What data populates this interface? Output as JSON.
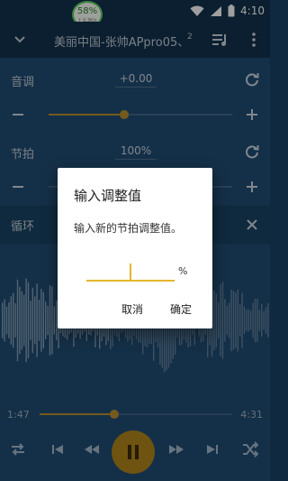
{
  "status_bar": {
    "net_percent": "58%",
    "net_speed": "↑ 0.3K/s",
    "time": "4:10"
  },
  "title_bar": {
    "title": "美丽中国-张帅APpro05、",
    "title_index": "2"
  },
  "controls": {
    "pitch": {
      "label": "音调",
      "value": "+0.00",
      "level": 0.41
    },
    "tempo": {
      "label": "节拍",
      "value": "100%"
    },
    "loop": {
      "label": "循环"
    }
  },
  "player": {
    "elapsed": "1:47",
    "total": "4:31",
    "progress": 0.39
  },
  "dialog": {
    "title": "输入调整值",
    "message": "输入新的节拍调整值。",
    "input_value": "",
    "suffix": "%",
    "cancel": "取消",
    "ok": "确定"
  },
  "colors": {
    "accent": "#e3b72b",
    "panel": "#1f4a6e",
    "header": "#123049"
  },
  "icons": {
    "collapse": "chevron-down-icon",
    "queue": "queue-music-icon",
    "more": "more-vert-icon",
    "reset": "refresh-icon",
    "minus": "minus-icon",
    "plus": "plus-icon",
    "close": "close-icon",
    "repeat": "repeat-icon",
    "prev": "skip-previous-icon",
    "rewind": "fast-rewind-icon",
    "pause": "pause-icon",
    "forward": "fast-forward-icon",
    "next": "skip-next-icon",
    "shuffle": "shuffle-icon"
  }
}
